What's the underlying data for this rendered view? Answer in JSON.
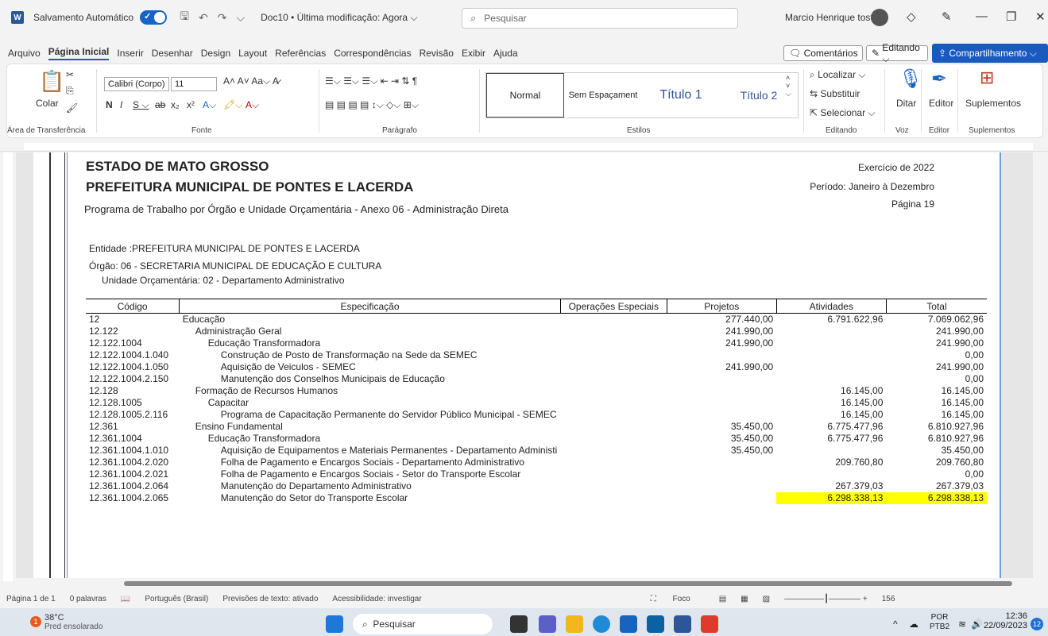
{
  "titlebar": {
    "autosave_label": "Salvamento Automático",
    "doc_title": "Doc10 • Última modificação: Agora ⌵",
    "search_placeholder": "Pesquisar",
    "user_name": "Marcio Henrique tosti"
  },
  "menu": [
    "Arquivo",
    "Página Inicial",
    "Inserir",
    "Desenhar",
    "Design",
    "Layout",
    "Referências",
    "Correspondências",
    "Revisão",
    "Exibir",
    "Ajuda"
  ],
  "menu_right": {
    "comments": "Comentários",
    "editing": "Editando ⌵",
    "share": "Compartilhamento ⌵"
  },
  "ribbon": {
    "paste": "Colar",
    "font_name": "Calibri (Corpo)",
    "font_size": "11",
    "styles": [
      "Normal",
      "Sem Espaçament",
      "Título 1",
      "Título 2"
    ],
    "find": "Localizar ⌵",
    "replace": "Substituir",
    "select": "Selecionar ⌵",
    "dictate": "Ditar",
    "editor": "Editor",
    "addins": "Suplementos",
    "groups": [
      "Área de Transferência",
      "Fonte",
      "Parágrafo",
      "Estilos",
      "Editando",
      "Voz",
      "Editor",
      "Suplementos"
    ]
  },
  "document": {
    "title1": "ESTADO DE MATO GROSSO",
    "title2": "PREFEITURA MUNICIPAL DE PONTES E LACERDA",
    "subtitle": "Programa de Trabalho por Órgão e Unidade Orçamentária - Anexo 06 - Administração Direta",
    "exercise": "Exercício de 2022",
    "period": "Período: Janeiro à Dezembro",
    "page": "Página 19",
    "entity": "Entidade :PREFEITURA MUNICIPAL DE PONTES E LACERDA",
    "organ": "Órgão:  06 - SECRETARIA MUNICIPAL DE EDUCAÇÃO E CULTURA",
    "unit": "Unidade Orçamentária:  02 - Departamento Administrativo",
    "columns": [
      "Código",
      "Especificação",
      "Operações Especiais",
      "Projetos",
      "Atividades",
      "Total"
    ],
    "rows": [
      {
        "code": "12",
        "spec": "Educação",
        "indent": 0,
        "op": "",
        "proj": "277.440,00",
        "ativ": "6.791.622,96",
        "total": "7.069.062,96",
        "hl": false
      },
      {
        "code": "12.122",
        "spec": "Administração Geral",
        "indent": 1,
        "op": "",
        "proj": "241.990,00",
        "ativ": "",
        "total": "241.990,00",
        "hl": false
      },
      {
        "code": "12.122.1004",
        "spec": "Educação Transformadora",
        "indent": 2,
        "op": "",
        "proj": "241.990,00",
        "ativ": "",
        "total": "241.990,00",
        "hl": false
      },
      {
        "code": "12.122.1004.1.040",
        "spec": "Construção de Posto de Transformação na Sede da SEMEC",
        "indent": 3,
        "op": "",
        "proj": "",
        "ativ": "",
        "total": "0,00",
        "hl": false
      },
      {
        "code": "12.122.1004.1.050",
        "spec": "Aquisição de Veiculos - SEMEC",
        "indent": 3,
        "op": "",
        "proj": "241.990,00",
        "ativ": "",
        "total": "241.990,00",
        "hl": false
      },
      {
        "code": "12.122.1004.2.150",
        "spec": "Manutenção dos Conselhos Municipais de Educação",
        "indent": 3,
        "op": "",
        "proj": "",
        "ativ": "",
        "total": "0,00",
        "hl": false
      },
      {
        "code": "12.128",
        "spec": "Formação de Recursos Humanos",
        "indent": 1,
        "op": "",
        "proj": "",
        "ativ": "16.145,00",
        "total": "16.145,00",
        "hl": false
      },
      {
        "code": "12.128.1005",
        "spec": "Capacitar",
        "indent": 2,
        "op": "",
        "proj": "",
        "ativ": "16.145,00",
        "total": "16.145,00",
        "hl": false
      },
      {
        "code": "12.128.1005.2.116",
        "spec": "Programa de Capacitação Permanente do Servidor Público Municipal - SEMEC",
        "indent": 3,
        "op": "",
        "proj": "",
        "ativ": "16.145,00",
        "total": "16.145,00",
        "hl": false
      },
      {
        "code": "12.361",
        "spec": "Ensino Fundamental",
        "indent": 1,
        "op": "",
        "proj": "35.450,00",
        "ativ": "6.775.477,96",
        "total": "6.810.927,96",
        "hl": false
      },
      {
        "code": "12.361.1004",
        "spec": "Educação Transformadora",
        "indent": 2,
        "op": "",
        "proj": "35.450,00",
        "ativ": "6.775.477,96",
        "total": "6.810.927,96",
        "hl": false
      },
      {
        "code": "12.361.1004.1.010",
        "spec": "Aquisição de Equipamentos e Materiais Permanentes - Departamento Administi",
        "indent": 3,
        "op": "",
        "proj": "35.450,00",
        "ativ": "",
        "total": "35.450,00",
        "hl": false
      },
      {
        "code": "12.361.1004.2.020",
        "spec": "Folha de Pagamento e Encargos Sociais - Departamento Administrativo",
        "indent": 3,
        "op": "",
        "proj": "",
        "ativ": "209.760,80",
        "total": "209.760,80",
        "hl": false
      },
      {
        "code": "12.361.1004.2.021",
        "spec": "Folha de Pagamento e Encargos Sociais - Setor do Transporte Escolar",
        "indent": 3,
        "op": "",
        "proj": "",
        "ativ": "",
        "total": "0,00",
        "hl": false
      },
      {
        "code": "12.361.1004.2.064",
        "spec": "Manutenção do Departamento Administrativo",
        "indent": 3,
        "op": "",
        "proj": "",
        "ativ": "267.379,03",
        "total": "267.379,03",
        "hl": false
      },
      {
        "code": "12.361.1004.2.065",
        "spec": "Manutenção do Setor do Transporte Escolar",
        "indent": 3,
        "op": "",
        "proj": "",
        "ativ": "6.298.338,13",
        "total": "6.298.338,13",
        "hl": true
      }
    ]
  },
  "status": {
    "page": "Página 1 de 1",
    "words": "0 palavras",
    "language": "Português (Brasil)",
    "predictions": "Previsões de texto: ativado",
    "accessibility": "Acessibilidade: investigar",
    "focus": "Foco",
    "zoom": "156"
  },
  "taskbar": {
    "temp": "38°C",
    "weather": "Pred ensolarado",
    "search": "Pesquisar",
    "lang1": "POR",
    "lang2": "PTB2",
    "time": "12:36",
    "date": "22/09/2023",
    "notif": "12"
  }
}
